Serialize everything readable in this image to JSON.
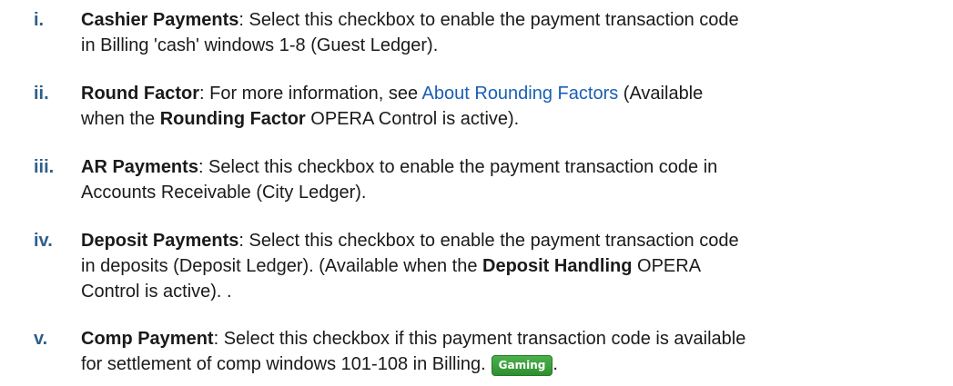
{
  "items": [
    {
      "marker": "i.",
      "term": "Cashier Payments",
      "line1_rest": ": Select this checkbox to enable the payment transaction code",
      "line2": "in Billing 'cash' windows 1-8 (Guest Ledger)."
    },
    {
      "marker": "ii.",
      "term": "Round Factor",
      "line1_mid": ": For more information, see ",
      "link": "About Rounding Factors",
      "line1_end": " (Available",
      "line2_pre": "when the ",
      "line2_bold": "Rounding Factor",
      "line2_post": " OPERA Control is active)."
    },
    {
      "marker": "iii.",
      "term": "AR Payments",
      "line1_rest": ": Select this checkbox to enable the payment transaction code in",
      "line2": "Accounts Receivable (City Ledger)."
    },
    {
      "marker": "iv.",
      "term": "Deposit Payments",
      "line1_rest": ": Select this checkbox to enable the payment transaction code",
      "line2_pre": "in deposits (Deposit Ledger). (Available when the ",
      "line2_bold": "Deposit Handling",
      "line2_post": " OPERA",
      "line3": "Control is active). ."
    },
    {
      "marker": "v.",
      "term": "Comp Payment",
      "line1_rest": ": Select this checkbox if this payment transaction code is available",
      "line2_pre": "for settlement of comp windows 101-108 in Billing.",
      "badge": "Gaming",
      "line2_post": "."
    }
  ]
}
